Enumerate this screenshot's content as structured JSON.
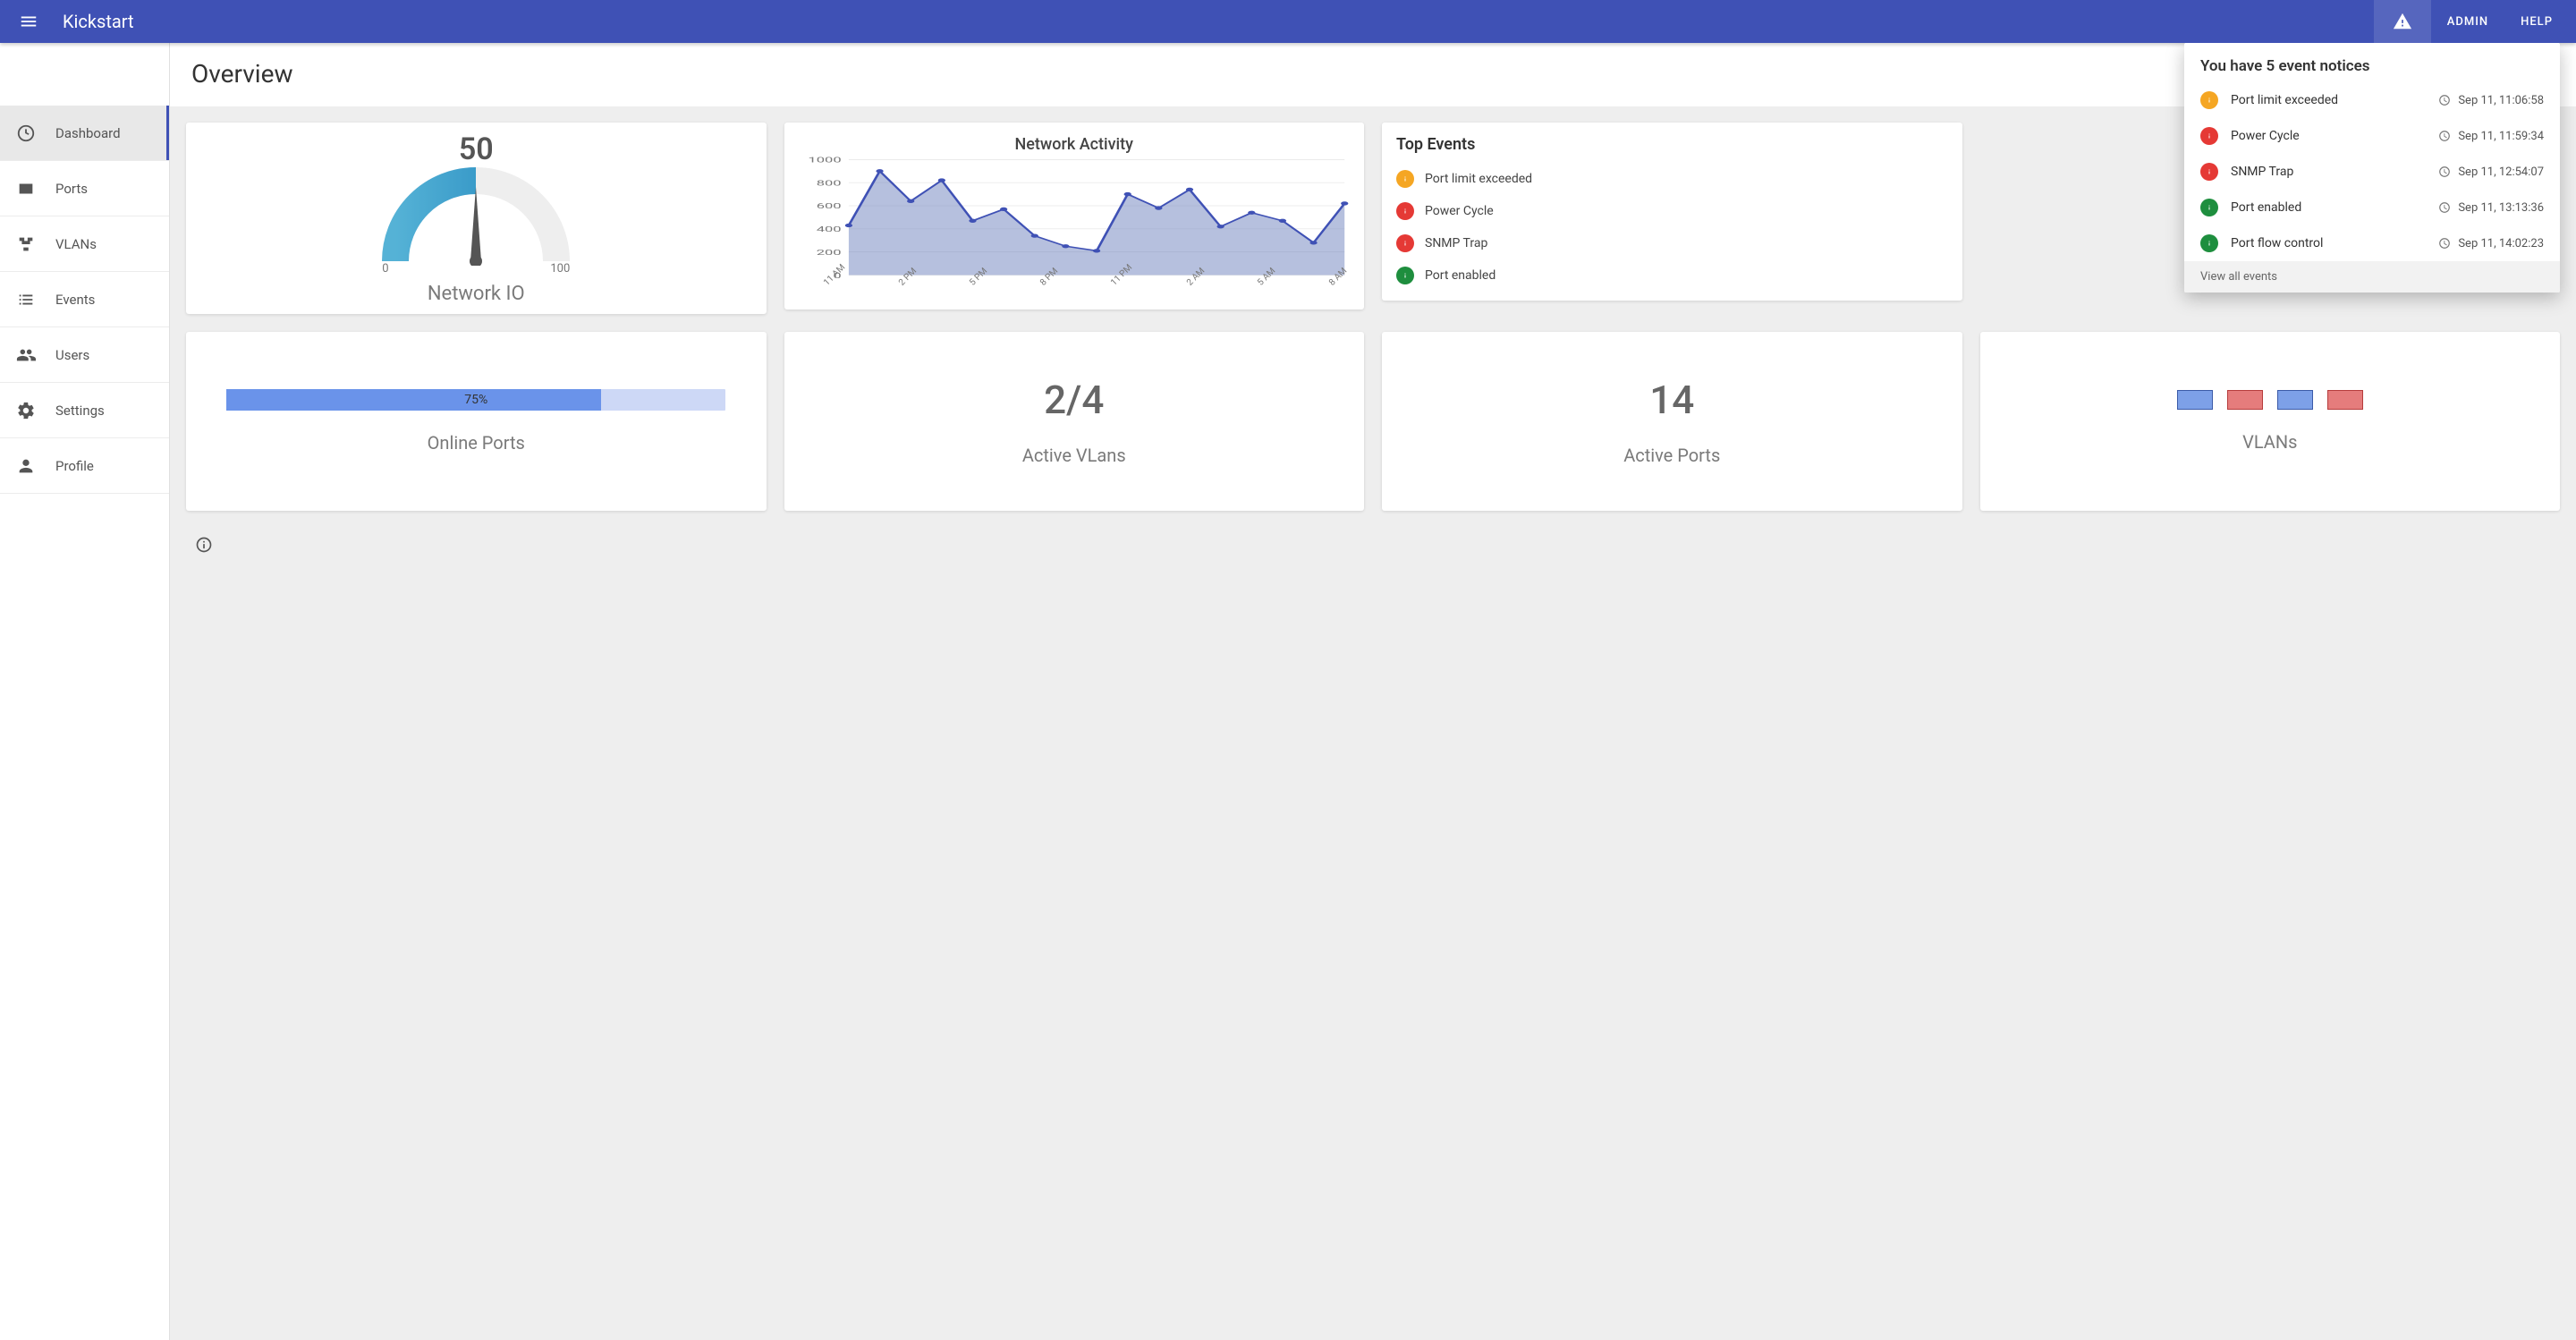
{
  "appbar": {
    "brand": "Kickstart",
    "admin_label": "ADMIN",
    "help_label": "HELP"
  },
  "sidebar": {
    "items": [
      {
        "icon": "dashboard",
        "label": "Dashboard",
        "active": true
      },
      {
        "icon": "ports",
        "label": "Ports",
        "active": false
      },
      {
        "icon": "vlans",
        "label": "VLANs",
        "active": false
      },
      {
        "icon": "events",
        "label": "Events",
        "active": false
      },
      {
        "icon": "users",
        "label": "Users",
        "active": false
      },
      {
        "icon": "settings",
        "label": "Settings",
        "active": false
      },
      {
        "icon": "profile",
        "label": "Profile",
        "active": false
      }
    ]
  },
  "page": {
    "title": "Overview"
  },
  "gauge": {
    "value": "50",
    "min": "0",
    "max": "100",
    "label": "Network IO"
  },
  "network_chart": {
    "title": "Network Activity"
  },
  "top_events": {
    "title": "Top Events",
    "items": [
      {
        "status": "warn",
        "text": "Port limit exceeded"
      },
      {
        "status": "err",
        "text": "Power Cycle"
      },
      {
        "status": "err",
        "text": "SNMP Trap"
      },
      {
        "status": "ok",
        "text": "Port enabled"
      }
    ]
  },
  "cards": {
    "online_ports": {
      "percent": "75%",
      "label": "Online Ports",
      "fill": 75
    },
    "active_vlans": {
      "value": "2/4",
      "label": "Active VLans"
    },
    "active_ports": {
      "value": "14",
      "label": "Active Ports"
    },
    "vlans": {
      "label": "VLANs"
    }
  },
  "notifications": {
    "title": "You have 5 event notices",
    "items": [
      {
        "status": "warn",
        "text": "Port limit exceeded",
        "time": "Sep 11, 11:06:58"
      },
      {
        "status": "err",
        "text": "Power Cycle",
        "time": "Sep 11, 11:59:34"
      },
      {
        "status": "err",
        "text": "SNMP Trap",
        "time": "Sep 11, 12:54:07"
      },
      {
        "status": "ok",
        "text": "Port enabled",
        "time": "Sep 11, 13:13:36"
      },
      {
        "status": "ok",
        "text": "Port flow control",
        "time": "Sep 11, 14:02:23"
      }
    ],
    "footer": "View all events"
  },
  "chart_data": {
    "type": "area",
    "title": "Network Activity",
    "xlabel": "",
    "ylabel": "",
    "ylim": [
      0,
      1000
    ],
    "y_ticks": [
      0,
      200,
      400,
      600,
      800,
      1000
    ],
    "categories": [
      "11 AM",
      "2 PM",
      "5 PM",
      "8 PM",
      "11 PM",
      "2 AM",
      "5 AM",
      "8 AM"
    ],
    "x": [
      0,
      1,
      2,
      3,
      4,
      5,
      6,
      7,
      8,
      9,
      10,
      11,
      12,
      13,
      14,
      15,
      16
    ],
    "values": [
      430,
      900,
      640,
      820,
      470,
      570,
      340,
      250,
      210,
      700,
      580,
      740,
      420,
      540,
      470,
      280,
      620
    ]
  }
}
